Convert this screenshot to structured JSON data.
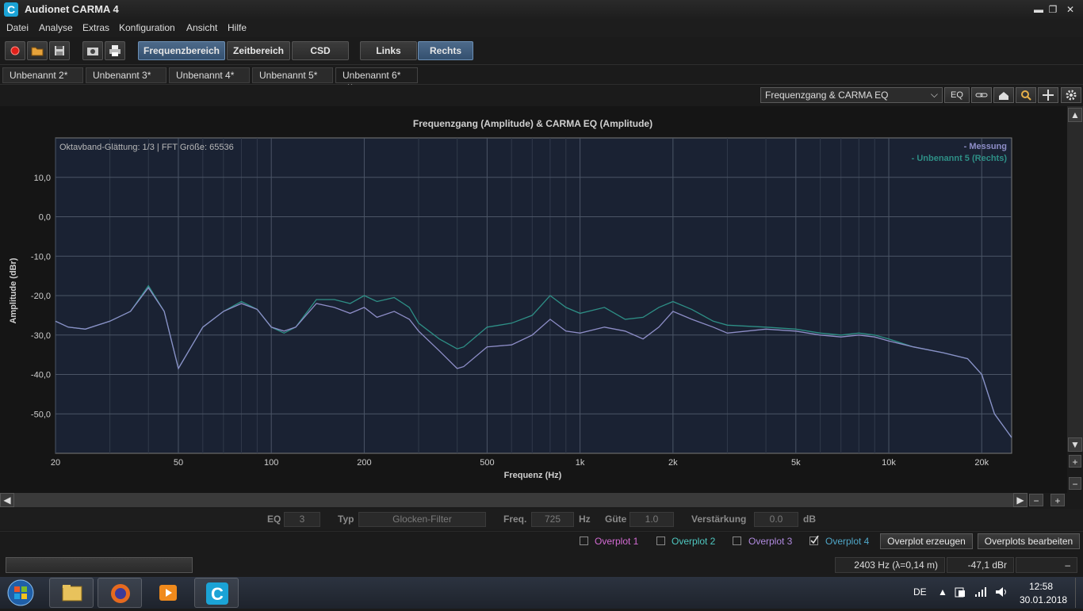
{
  "app": {
    "logo_letter": "C",
    "title": "Audionet CARMA 4",
    "window_controls": [
      "minimize-icon",
      "restore-icon",
      "close-icon"
    ]
  },
  "menu": [
    "Datei",
    "Analyse",
    "Extras",
    "Konfiguration",
    "Ansicht",
    "Hilfe"
  ],
  "toolbar": {
    "icons": [
      "record-icon",
      "open-folder-icon",
      "save-icon",
      "screenshot-icon",
      "print-icon"
    ],
    "view_buttons": [
      "Frequenzbereich",
      "Zeitbereich",
      "CSD"
    ],
    "channel_buttons": [
      "Links",
      "Rechts"
    ]
  },
  "tabs": [
    "Unbenannt 2*",
    "Unbenannt 3*",
    "Unbenannt 4*",
    "Unbenannt 5*",
    "Unbenannt 6*"
  ],
  "tab_close": "×",
  "chart_toolbar": {
    "view_select": "Frequenzgang & CARMA EQ",
    "eq_button": "EQ",
    "icons": [
      "link-icon",
      "home-icon",
      "zoom-icon",
      "pan-icon",
      "settings-icon"
    ]
  },
  "chart_data": {
    "type": "line",
    "title": "Frequenzgang (Amplitude) & CARMA EQ (Amplitude)",
    "subtitle": "Oktavband-Glättung: 1/3 | FFT Größe: 65536",
    "xlabel": "Frequenz (Hz)",
    "ylabel": "Amplitude (dBr)",
    "x_scale": "log",
    "xlim": [
      20,
      25000
    ],
    "ylim": [
      -60,
      20
    ],
    "x_ticks": [
      20,
      50,
      100,
      200,
      500,
      1000,
      2000,
      5000,
      10000,
      20000
    ],
    "x_tick_labels": [
      "20",
      "50",
      "100",
      "200",
      "500",
      "1k",
      "2k",
      "5k",
      "10k",
      "20k"
    ],
    "y_ticks": [
      10,
      0,
      -10,
      -20,
      -30,
      -40,
      -50
    ],
    "y_tick_labels": [
      "10,0",
      "0,0",
      "-10,0",
      "-20,0",
      "-30,0",
      "-40,0",
      "-50,0"
    ],
    "grid": true,
    "legend": "top-right",
    "series": [
      {
        "name": "- Messung",
        "color": "#8e8ec8",
        "x": [
          20,
          22,
          25,
          30,
          35,
          40,
          45,
          50,
          55,
          60,
          70,
          80,
          90,
          100,
          110,
          120,
          140,
          160,
          180,
          200,
          220,
          250,
          280,
          300,
          350,
          400,
          420,
          500,
          600,
          700,
          800,
          900,
          1000,
          1200,
          1400,
          1600,
          1800,
          2000,
          2300,
          2700,
          3000,
          4000,
          5000,
          6000,
          7000,
          8000,
          9000,
          10000,
          12000,
          15000,
          18000,
          20000,
          22000,
          25000
        ],
        "y": [
          -26.5,
          -28,
          -28.5,
          -26.5,
          -24,
          -18,
          -24,
          -38.5,
          -33,
          -28,
          -24,
          -22,
          -23.5,
          -28,
          -29,
          -28,
          -22,
          -23,
          -24.5,
          -23,
          -25.5,
          -24,
          -26,
          -29,
          -34,
          -38.5,
          -38,
          -33,
          -32.5,
          -30,
          -26,
          -29,
          -29.5,
          -28,
          -29,
          -31,
          -28,
          -24,
          -26,
          -28,
          -29.5,
          -28.5,
          -29,
          -30,
          -30.5,
          -30,
          -30.5,
          -31.5,
          -33,
          -34.5,
          -36,
          -40,
          -50,
          -56
        ]
      },
      {
        "name": "- Unbenannt 5 (Rechts)",
        "color": "#2e8f86",
        "x": [
          20,
          22,
          25,
          30,
          35,
          40,
          45,
          50,
          55,
          60,
          70,
          80,
          90,
          100,
          110,
          120,
          140,
          160,
          180,
          200,
          220,
          250,
          280,
          300,
          350,
          400,
          420,
          500,
          600,
          700,
          800,
          900,
          1000,
          1200,
          1400,
          1600,
          1800,
          2000,
          2300,
          2700,
          3000,
          4000,
          5000,
          6000,
          7000,
          8000,
          9000,
          10000,
          12000,
          15000,
          18000,
          20000,
          22000,
          25000
        ],
        "y": [
          -26.5,
          -28,
          -28.5,
          -26.5,
          -24,
          -17.5,
          -24,
          -38.5,
          -33,
          -28,
          -24,
          -21.5,
          -23.5,
          -28,
          -29.5,
          -28,
          -21,
          -21,
          -22,
          -20,
          -21.5,
          -20.5,
          -23,
          -27,
          -31,
          -33.5,
          -33,
          -28,
          -27,
          -25,
          -20,
          -23,
          -24.5,
          -23,
          -26,
          -25.5,
          -23,
          -21.5,
          -23.5,
          -26.5,
          -27.5,
          -28,
          -28.5,
          -29.5,
          -30,
          -29.5,
          -30,
          -31,
          -33,
          -34.5,
          -36,
          -40,
          -50,
          -56
        ]
      }
    ]
  },
  "eq": {
    "eq_label": "EQ",
    "eq_value": "3",
    "typ_label": "Typ",
    "typ_value": "Glocken-Filter",
    "freq_label": "Freq.",
    "freq_value": "725",
    "freq_unit": "Hz",
    "gute_label": "Güte",
    "gute_value": "1.0",
    "gain_label": "Verstärkung",
    "gain_value": "0.0",
    "gain_unit": "dB"
  },
  "overplots": {
    "items": [
      {
        "label": "Overplot 1",
        "checked": false,
        "color": "#d36bd3"
      },
      {
        "label": "Overplot 2",
        "checked": false,
        "color": "#4fc7c0"
      },
      {
        "label": "Overplot 3",
        "checked": false,
        "color": "#b08adf"
      },
      {
        "label": "Overplot 4",
        "checked": true,
        "color": "#4fa6c7"
      }
    ],
    "create_button": "Overplot erzeugen",
    "edit_button": "Overplots bearbeiten"
  },
  "status": {
    "cursor_freq": "2403 Hz (λ=0,14 m)",
    "cursor_level": "-47,1 dBr"
  },
  "taskbar": {
    "apps": [
      "windows-start-icon",
      "file-explorer-icon",
      "firefox-icon",
      "media-player-icon",
      "carma-icon"
    ],
    "language": "DE",
    "time": "12:58",
    "date": "30.01.2018"
  }
}
